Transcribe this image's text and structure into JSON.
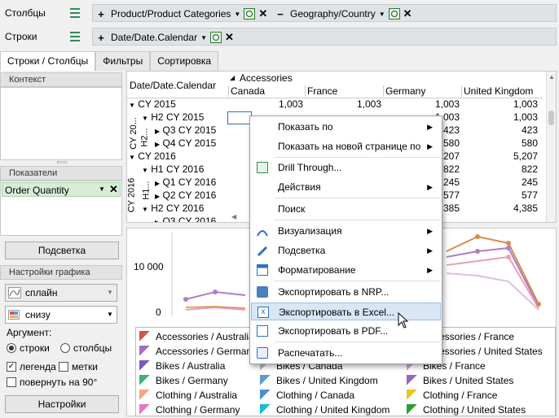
{
  "toolbar": {
    "columns_label": "Столбцы",
    "rows_label": "Строки",
    "columns_chips": [
      {
        "sign": "+",
        "label": "Product/Product Categories"
      },
      {
        "sign": "−",
        "label": "Geography/Country"
      }
    ],
    "rows_chips": [
      {
        "sign": "+",
        "label": "Date/Date.Calendar"
      }
    ]
  },
  "tabs": [
    "Строки / Столбцы",
    "Фильтры",
    "Сортировка"
  ],
  "left": {
    "context_header": "Контекст",
    "measures_header": "Показатели",
    "measure": "Order Quantity",
    "highlight_button": "Подсветка",
    "chart_settings_header": "Настройки графика",
    "chart_type": "сплайн",
    "legend_position": "снизу",
    "argument_label": "Аргумент:",
    "radio_rows": "строки",
    "radio_cols": "столбцы",
    "check_legend": "легенда",
    "check_labels": "метки",
    "check_rotate": "повернуть на 90°",
    "settings_button": "Настройки"
  },
  "grid": {
    "corner": "Date/Date.Calendar",
    "category": "Accessories",
    "columns": [
      "Canada",
      "France",
      "Germany",
      "United Kingdom"
    ],
    "rows": [
      {
        "label": "CY 2015",
        "values": [
          "1,003",
          "1,003",
          "1,003",
          "1,003"
        ]
      },
      {
        "label": "H2 CY 2015",
        "values": [
          "",
          "",
          "1,003",
          "1,003"
        ]
      },
      {
        "label": "Q3 CY 2015",
        "values": [
          "",
          "",
          "423",
          "423"
        ]
      },
      {
        "label": "Q4 CY 2015",
        "values": [
          "",
          "",
          "580",
          "580"
        ]
      },
      {
        "label": "CY 2016",
        "values": [
          "",
          "",
          "207",
          "5,207"
        ]
      },
      {
        "label": "H1 CY 2016",
        "values": [
          "",
          "",
          "822",
          "822"
        ]
      },
      {
        "label": "Q1 CY 2016",
        "values": [
          "",
          "",
          "245",
          "245"
        ]
      },
      {
        "label": "Q2 CY 2016",
        "values": [
          "",
          "",
          "577",
          "577"
        ]
      },
      {
        "label": "H2 CY 2016",
        "values": [
          "",
          "",
          "385",
          "4,385"
        ]
      },
      {
        "label": "Q3 CY 2016",
        "values": [
          "",
          "",
          "",
          ""
        ]
      }
    ],
    "vertical_labels": [
      "CY 20...",
      "H2...",
      "CY 2016",
      "H1..."
    ]
  },
  "context_menu": {
    "items": [
      {
        "label": "Показать по",
        "sub": true
      },
      {
        "label": "Показать на новой странице по",
        "sub": true
      },
      {
        "label": "Drill Through...",
        "sub": false
      },
      {
        "label": "Действия",
        "sub": true
      },
      {
        "label": "Поиск",
        "sub": false
      },
      {
        "label": "Визуализация",
        "sub": true
      },
      {
        "label": "Подсветка",
        "sub": true
      },
      {
        "label": "Форматирование",
        "sub": true
      },
      {
        "label": "Экспортировать в NRP...",
        "sub": false
      },
      {
        "label": "Экспортировать в Excel...",
        "sub": false
      },
      {
        "label": "Экспортировать в PDF...",
        "sub": false
      },
      {
        "label": "Распечатать...",
        "sub": false
      }
    ]
  },
  "chart": {
    "ytick_10000": "10 000",
    "ytick_0": "0",
    "legend": [
      "Accessories / Australia",
      "Accessories / France",
      "Accessories / Germany",
      "Accessories / United States",
      "Bikes / Australia",
      "Bikes / Canada",
      "Bikes / France",
      "Bikes / Germany",
      "Bikes / United Kingdom",
      "Bikes / United States",
      "Clothing / Australia",
      "Clothing / Canada",
      "Clothing / France",
      "Clothing / Germany",
      "Clothing / United Kingdom",
      "Clothing / United States"
    ]
  },
  "colors": {
    "accent_green": "#2e8b57",
    "highlight": "#d8e6f6",
    "series_orange": "#d98a4a",
    "series_purple": "#b07cc6",
    "series_pink": "#e8a0b8"
  }
}
